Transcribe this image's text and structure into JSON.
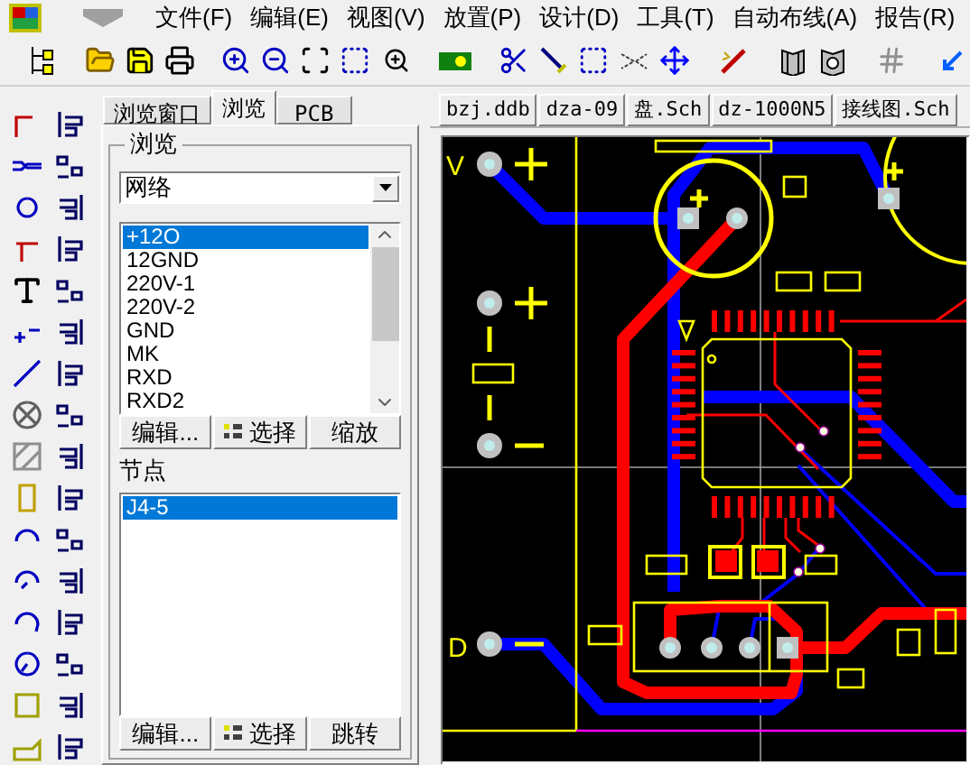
{
  "menu": [
    "文件(F)",
    "编辑(E)",
    "视图(V)",
    "放置(P)",
    "设计(D)",
    "工具(T)",
    "自动布线(A)",
    "报告(R)"
  ],
  "browser_panel": {
    "tabs": [
      {
        "label": "浏览窗口",
        "selected": false
      },
      {
        "label": "浏览",
        "selected": true
      },
      {
        "label": "PCB",
        "selected": false
      }
    ],
    "group_title": "浏览",
    "dropdown": {
      "value": "网络"
    },
    "net_list": {
      "items": [
        {
          "label": "+12O",
          "selected": true
        },
        {
          "label": "12GND",
          "selected": false
        },
        {
          "label": "220V-1",
          "selected": false
        },
        {
          "label": "220V-2",
          "selected": false
        },
        {
          "label": "GND",
          "selected": false
        },
        {
          "label": "MK",
          "selected": false
        },
        {
          "label": "RXD",
          "selected": false
        },
        {
          "label": "RXD2",
          "selected": false
        }
      ]
    },
    "net_buttons": [
      {
        "label": "编辑...",
        "kind": "plain"
      },
      {
        "label": "选择",
        "kind": "icon"
      },
      {
        "label": "缩放",
        "kind": "plain"
      }
    ],
    "node_title": "节点",
    "node_list": {
      "items": [
        {
          "label": "J4-5",
          "selected": true
        }
      ]
    },
    "node_buttons": [
      {
        "label": "编辑...",
        "kind": "plain"
      },
      {
        "label": "选择",
        "kind": "icon"
      },
      {
        "label": "跳转",
        "kind": "plain"
      }
    ]
  },
  "document_tabs": [
    "bzj.ddb",
    "dza-09",
    "盘.Sch",
    "dz-1000N5",
    "接线图.Sch"
  ],
  "canvas": {
    "labels": [
      "V",
      "D"
    ]
  }
}
